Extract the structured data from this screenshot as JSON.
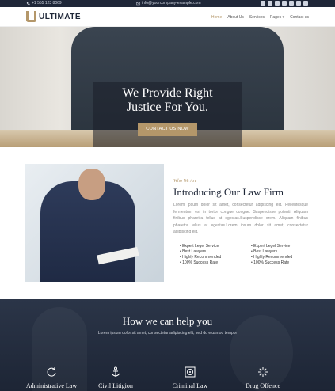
{
  "topbar": {
    "phone": "+1 555 123 8069",
    "email": "info@yourcompany-example.com",
    "socials": [
      "facebook-icon",
      "twitter-icon",
      "linkedin-icon",
      "instagram-icon",
      "youtube-icon",
      "mail-icon",
      "skype-icon"
    ]
  },
  "header": {
    "brand": "ULTIMATE",
    "nav": [
      "Home",
      "About Us",
      "Services",
      "Pages ▾",
      "Contact us"
    ]
  },
  "hero": {
    "title_line1": "We Provide Right",
    "title_line2": "Justice For You.",
    "cta": "CONTACT US NOW"
  },
  "about": {
    "subtitle": "Who We Are",
    "title": "Introducing Our Law Firm",
    "text": "Lorem ipsum dolor sit amet, consectetur adipiscing elit. Pellentesque fermentum est in tortor congue congue. Suspendisse potenti. Aliquam finibus pharetra tellus at egestas.Suspendisse orem. Aliquam finibus pharetra tellus at egestas.Lorem ipsum dolor sit amet, consectetur adipiscing elit.",
    "features_left": [
      "Expert Legel Service",
      "Best Lawyers",
      "Highly Recommended",
      "100% Success Rate"
    ],
    "features_right": [
      "Expert Legel Service",
      "Best Lawyers",
      "Highly Recommended",
      "100% Success Rate"
    ]
  },
  "services": {
    "title": "How we can help you",
    "subtitle": "Lorem ipsum dolor sit amet, consectetur adipiscing elit, sed do eiusmod tempor",
    "items": [
      {
        "name": "Administrative Law",
        "icon": "refresh-icon"
      },
      {
        "name": "Civil Litigion",
        "icon": "anchor-icon"
      },
      {
        "name": "Criminal Law",
        "icon": "target-icon"
      },
      {
        "name": "Drug Offence",
        "icon": "gear-icon"
      }
    ]
  },
  "colors": {
    "accent": "#b4976a",
    "dark": "#1f2738"
  }
}
